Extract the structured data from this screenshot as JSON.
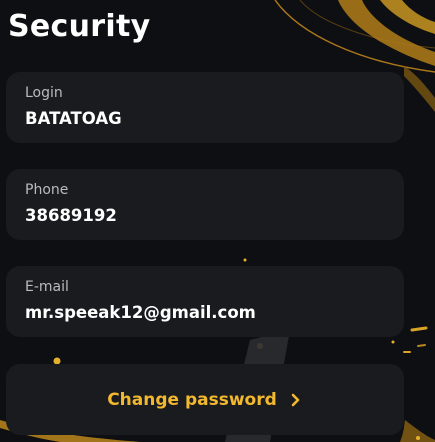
{
  "page": {
    "title": "Security"
  },
  "fields": {
    "login": {
      "label": "Login",
      "value": "BATATOAG"
    },
    "phone": {
      "label": "Phone",
      "value": "38689192"
    },
    "email": {
      "label": "E-mail",
      "value": "mr.speeak12@gmail.com"
    }
  },
  "actions": {
    "change_password": {
      "label": "Change password",
      "icon": "chevron-right-icon"
    }
  },
  "theme": {
    "background": "#0d0f12",
    "card": "#1a1b1f",
    "accent": "#f2b82e",
    "label": "#b9bbc0",
    "text": "#ffffff"
  }
}
